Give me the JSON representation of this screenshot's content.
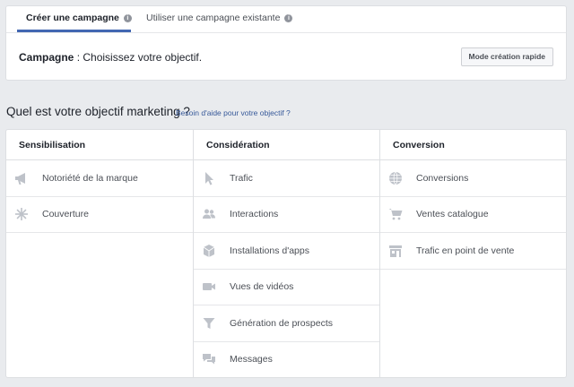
{
  "tabs": [
    {
      "label": "Créer une campagne",
      "active": true
    },
    {
      "label": "Utiliser une campagne existante",
      "active": false
    }
  ],
  "campaign": {
    "label": "Campagne",
    "text": " : Choisissez votre objectif."
  },
  "quick_button": "Mode création rapide",
  "question": "Quel est votre objectif marketing ?",
  "help_link": "Besoin d'aide pour votre objectif ?",
  "columns": [
    {
      "title": "Sensibilisation",
      "items": [
        {
          "label": "Notoriété de la marque",
          "icon": "megaphone-icon"
        },
        {
          "label": "Couverture",
          "icon": "snowflake-icon"
        }
      ]
    },
    {
      "title": "Considération",
      "items": [
        {
          "label": "Trafic",
          "icon": "cursor-icon"
        },
        {
          "label": "Interactions",
          "icon": "people-icon"
        },
        {
          "label": "Installations d'apps",
          "icon": "cube-icon"
        },
        {
          "label": "Vues de vidéos",
          "icon": "video-camera-icon"
        },
        {
          "label": "Génération de prospects",
          "icon": "funnel-icon"
        },
        {
          "label": "Messages",
          "icon": "chat-bubbles-icon"
        }
      ]
    },
    {
      "title": "Conversion",
      "items": [
        {
          "label": "Conversions",
          "icon": "globe-icon"
        },
        {
          "label": "Ventes catalogue",
          "icon": "shopping-cart-icon"
        },
        {
          "label": "Trafic en point de vente",
          "icon": "storefront-icon"
        }
      ]
    }
  ],
  "colors": {
    "accent": "#4267b2",
    "link": "#365899",
    "icon_gray": "#bec2c9",
    "background": "#e9ebee"
  }
}
